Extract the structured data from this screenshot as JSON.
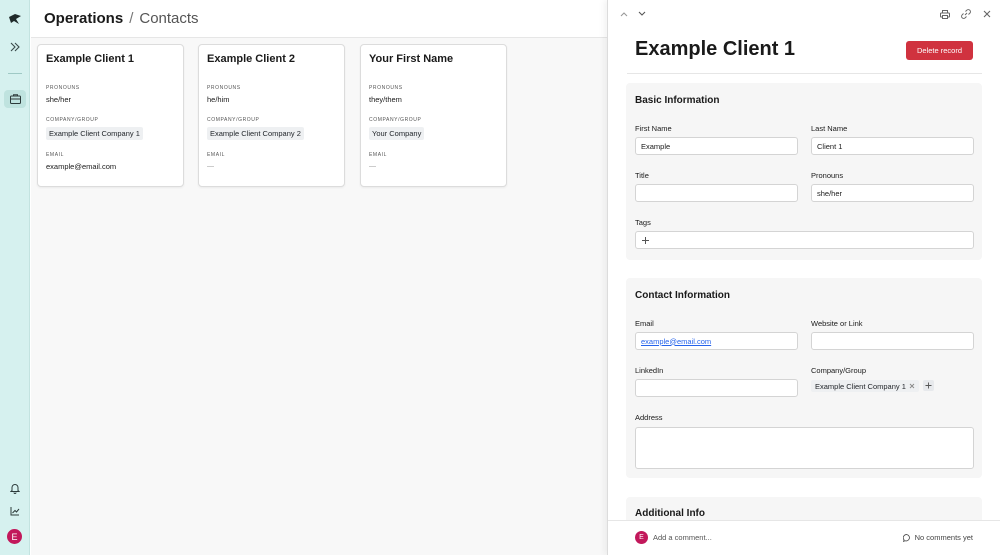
{
  "sidebar": {
    "avatar_letter": "E",
    "icons": [
      "logo-icon",
      "expand-icon",
      "contacts-icon",
      "bell-icon",
      "analytics-icon"
    ]
  },
  "header": {
    "title": "Operations",
    "separator": "/",
    "subtitle": "Contacts"
  },
  "cards": [
    {
      "title": "Example Client 1",
      "pronouns_label": "PRONOUNS",
      "pronouns": "she/her",
      "company_label": "COMPANY/GROUP",
      "company": "Example Client Company 1",
      "email_label": "EMAIL",
      "email": "example@email.com"
    },
    {
      "title": "Example Client 2",
      "pronouns_label": "PRONOUNS",
      "pronouns": "he/him",
      "company_label": "COMPANY/GROUP",
      "company": "Example Client Company 2",
      "email_label": "EMAIL",
      "email": ""
    },
    {
      "title": "Your First Name",
      "pronouns_label": "PRONOUNS",
      "pronouns": "they/them",
      "company_label": "COMPANY/GROUP",
      "company": "Your Company",
      "email_label": "EMAIL",
      "email": ""
    }
  ],
  "panel": {
    "record_title": "Example Client 1",
    "delete_label": "Delete record",
    "basic": {
      "title": "Basic Information",
      "first_name_label": "First Name",
      "first_name": "Example",
      "last_name_label": "Last Name",
      "last_name": "Client 1",
      "title_label": "Title",
      "title_value": "",
      "pronouns_label": "Pronouns",
      "pronouns": "she/her",
      "tags_label": "Tags"
    },
    "contact": {
      "title": "Contact Information",
      "email_label": "Email",
      "email": "example@email.com",
      "website_label": "Website or Link",
      "website": "",
      "linkedin_label": "LinkedIn",
      "linkedin": "",
      "company_label": "Company/Group",
      "company": "Example Client Company 1",
      "address_label": "Address",
      "address": ""
    },
    "additional": {
      "title": "Additional Info"
    },
    "comment": {
      "avatar_letter": "E",
      "placeholder": "Add a comment...",
      "status": "No comments yet"
    }
  },
  "colors": {
    "sidebar_bg": "#d6f1ef",
    "delete_button": "#d0323f",
    "avatar": "#c2185b",
    "link": "#2563eb"
  }
}
